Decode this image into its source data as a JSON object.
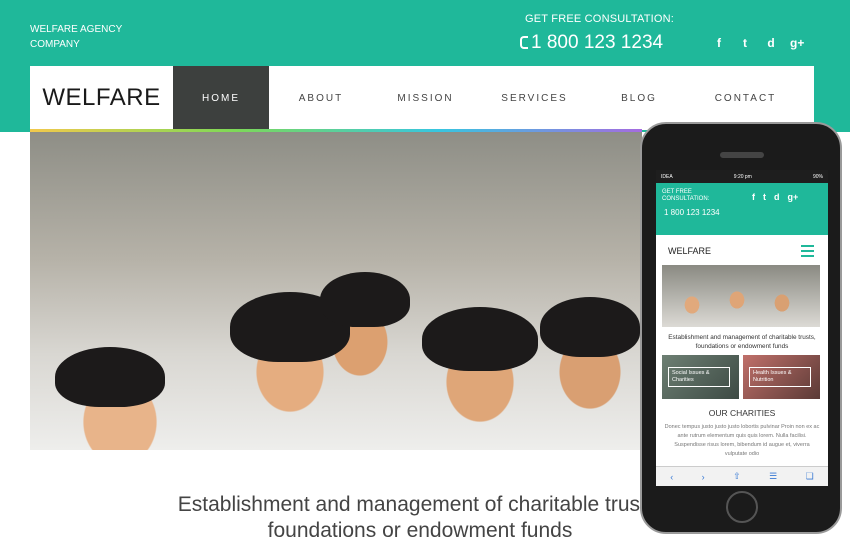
{
  "header": {
    "company": "WELFARE AGENCY COMPANY",
    "consult_label": "GET FREE CONSULTATION:",
    "phone": "1 800 123 1234",
    "socials": [
      "f",
      "t",
      "d",
      "g+"
    ],
    "social_icons": [
      "facebook-icon",
      "twitter-icon",
      "dribbble-icon",
      "google-plus-icon"
    ]
  },
  "nav": {
    "logo": "WELFARE",
    "items": [
      "HOME",
      "ABOUT",
      "MISSION",
      "SERVICES",
      "BLOG",
      "CONTACT"
    ],
    "active": "HOME"
  },
  "hero": {
    "image": "group of smiling schoolchildren waving"
  },
  "tagline": "Establishment and management of charitable trusts, foundations or endowment funds",
  "mobile": {
    "status_left": "IDEA",
    "status_time": "9:20 pm",
    "status_right": "90%",
    "consult_label": "GET FREE CONSULTATION:",
    "phone": "1 800 123 1234",
    "logo": "WELFARE",
    "tagline": "Establishment and management of charitable trusts, foundations or endowment funds",
    "cards": [
      "Social Issues & Charities",
      "Health Issues & Nutrition"
    ],
    "charities_title": "OUR CHARITIES",
    "charities_text": "Donec tempus justo justo justo lobortis pulvinar Proin non ex ac ante rutrum elementum quis quis lorem. Nulla facilisi. Suspendisse risus lorem, bibendum id augue et, viverra vulputate odio"
  },
  "colors": {
    "accent": "#1fb89a",
    "nav_active": "#3d403e"
  }
}
